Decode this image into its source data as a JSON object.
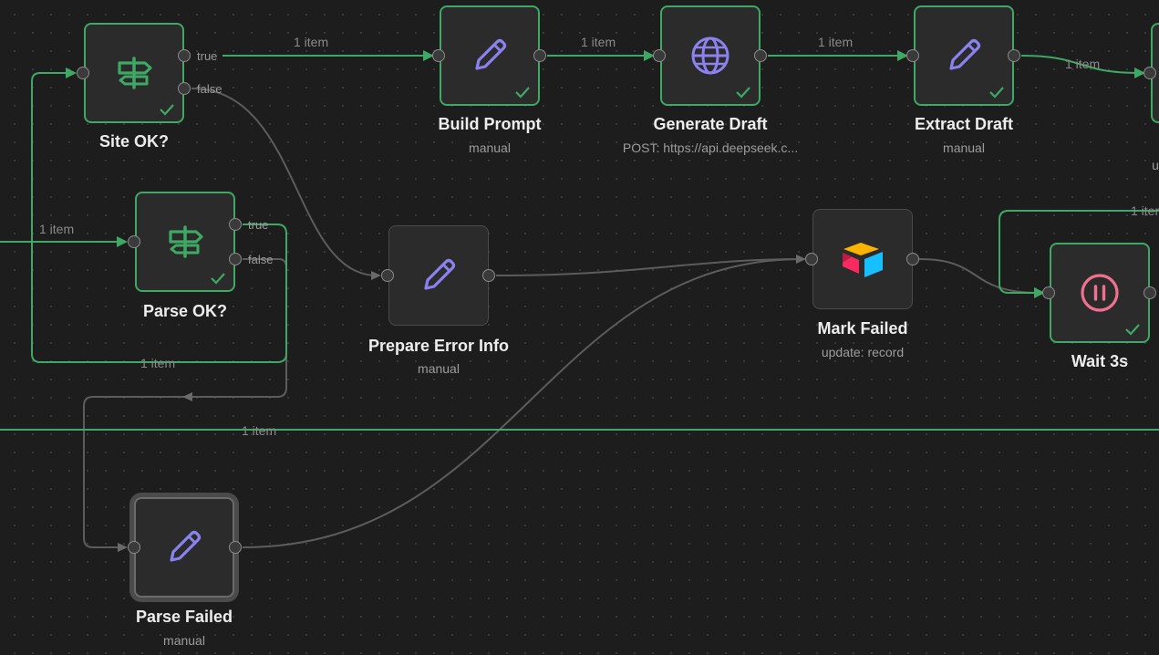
{
  "colors": {
    "canvas_bg": "#1d1d1d",
    "success_green": "#3ea864",
    "edge_gray": "#5a5a5a",
    "icon_purple": "#8b82f0",
    "wait_pink": "#f07090"
  },
  "edge_labels": {
    "site_true_to_build": "1 item",
    "build_to_generate": "1 item",
    "generate_to_extract": "1 item",
    "extract_to_next": "1 item",
    "input_to_parse_ok": "1 item",
    "parse_true_loop": "1 item",
    "wait_loop": "1 item",
    "bottom_line": "1 item"
  },
  "ports": {
    "true_label": "true",
    "false_label": "false"
  },
  "nodes": {
    "site_ok": {
      "title": "Site OK?",
      "icon": "signpost-icon"
    },
    "parse_ok": {
      "title": "Parse OK?",
      "icon": "signpost-icon"
    },
    "build_prompt": {
      "title": "Build Prompt",
      "subtitle": "manual",
      "icon": "pencil-icon"
    },
    "generate_draft": {
      "title": "Generate Draft",
      "subtitle": "POST: https://api.deepseek.c...",
      "icon": "globe-icon"
    },
    "extract_draft": {
      "title": "Extract Draft",
      "subtitle": "manual",
      "icon": "pencil-icon"
    },
    "prepare_error_info": {
      "title": "Prepare Error Info",
      "subtitle": "manual",
      "icon": "pencil-icon"
    },
    "mark_failed": {
      "title": "Mark Failed",
      "subtitle": "update: record",
      "icon": "airtable-icon"
    },
    "wait_3s": {
      "title": "Wait 3s",
      "icon": "pause-icon"
    },
    "parse_failed": {
      "title": "Parse Failed",
      "subtitle": "manual",
      "icon": "pencil-icon"
    },
    "offscreen_next": {
      "subtitle_fragment": "u"
    }
  }
}
